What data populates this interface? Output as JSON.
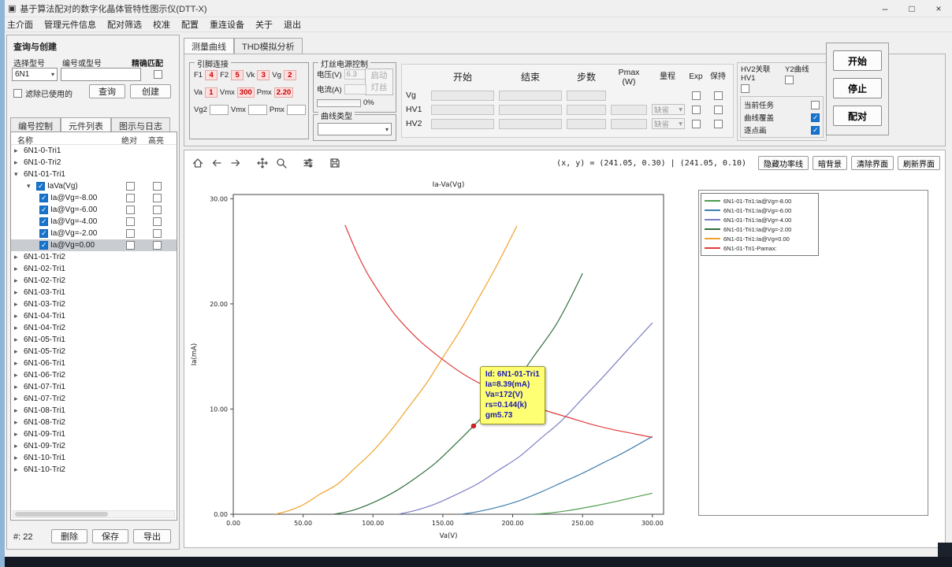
{
  "window": {
    "title": "基于算法配对的数字化晶体管特性图示仪(DTT-X)",
    "controls": {
      "minimize": "–",
      "maximize": "□",
      "close": "×"
    }
  },
  "menu": {
    "items": [
      "主介面",
      "管理元件信息",
      "配对筛选",
      "校准",
      "配置",
      "重连设备",
      "关于",
      "退出"
    ]
  },
  "query_panel": {
    "title": "查询与创建",
    "model_label": "选择型号",
    "model_value": "6N1",
    "code_label": "编号或型号",
    "code_value": "",
    "exact_label": "精确匹配",
    "filter_label": "滤除已使用的",
    "query_btn": "查询",
    "create_btn": "创建",
    "tabs": [
      {
        "label": "编号控制",
        "active": false
      },
      {
        "label": "元件列表",
        "active": true
      },
      {
        "label": "图示与日志",
        "active": false
      }
    ],
    "tree": {
      "columns": [
        "名称",
        "绝对",
        "高亮"
      ],
      "items": [
        {
          "label": "6N1-0-Tri1",
          "depth": 0,
          "arrow": "collapsed"
        },
        {
          "label": "6N1-0-Tri2",
          "depth": 0,
          "arrow": "collapsed"
        },
        {
          "label": "6N1-01-Tri1",
          "depth": 0,
          "arrow": "expanded"
        },
        {
          "label": "IaVa(Vg)",
          "depth": 1,
          "arrow": "expanded",
          "checked": true,
          "cols": true
        },
        {
          "label": "Ia@Vg=-8.00",
          "depth": 2,
          "checked": true,
          "cols": true
        },
        {
          "label": "Ia@Vg=-6.00",
          "depth": 2,
          "checked": true,
          "cols": true
        },
        {
          "label": "Ia@Vg=-4.00",
          "depth": 2,
          "checked": true,
          "cols": true
        },
        {
          "label": "Ia@Vg=-2.00",
          "depth": 2,
          "checked": true,
          "cols": true
        },
        {
          "label": "Ia@Vg=0.00",
          "depth": 2,
          "checked": true,
          "cols": true,
          "selected": true
        },
        {
          "label": "6N1-01-Tri2",
          "depth": 0,
          "arrow": "collapsed"
        },
        {
          "label": "6N1-02-Tri1",
          "depth": 0,
          "arrow": "collapsed"
        },
        {
          "label": "6N1-02-Tri2",
          "depth": 0,
          "arrow": "collapsed"
        },
        {
          "label": "6N1-03-Tri1",
          "depth": 0,
          "arrow": "collapsed"
        },
        {
          "label": "6N1-03-Tri2",
          "depth": 0,
          "arrow": "collapsed"
        },
        {
          "label": "6N1-04-Tri1",
          "depth": 0,
          "arrow": "collapsed"
        },
        {
          "label": "6N1-04-Tri2",
          "depth": 0,
          "arrow": "collapsed"
        },
        {
          "label": "6N1-05-Tri1",
          "depth": 0,
          "arrow": "collapsed"
        },
        {
          "label": "6N1-05-Tri2",
          "depth": 0,
          "arrow": "collapsed"
        },
        {
          "label": "6N1-06-Tri1",
          "depth": 0,
          "arrow": "collapsed"
        },
        {
          "label": "6N1-06-Tri2",
          "depth": 0,
          "arrow": "collapsed"
        },
        {
          "label": "6N1-07-Tri1",
          "depth": 0,
          "arrow": "collapsed"
        },
        {
          "label": "6N1-07-Tri2",
          "depth": 0,
          "arrow": "collapsed"
        },
        {
          "label": "6N1-08-Tri1",
          "depth": 0,
          "arrow": "collapsed"
        },
        {
          "label": "6N1-08-Tri2",
          "depth": 0,
          "arrow": "collapsed"
        },
        {
          "label": "6N1-09-Tri1",
          "depth": 0,
          "arrow": "collapsed"
        },
        {
          "label": "6N1-09-Tri2",
          "depth": 0,
          "arrow": "collapsed"
        },
        {
          "label": "6N1-10-Tri1",
          "depth": 0,
          "arrow": "collapsed"
        },
        {
          "label": "6N1-10-Tri2",
          "depth": 0,
          "arrow": "collapsed"
        }
      ]
    },
    "count": "#: 22",
    "delete_btn": "删除",
    "save_btn": "保存",
    "export_btn": "导出"
  },
  "main": {
    "tabs": [
      {
        "label": "测量曲线",
        "active": true
      },
      {
        "label": "THD模拟分析",
        "active": false
      }
    ],
    "pin_group": {
      "title": "引脚连接",
      "rows": [
        [
          {
            "label": "F1",
            "value": "4"
          },
          {
            "label": "F2",
            "value": "5"
          },
          {
            "label": "Vk",
            "value": "3"
          },
          {
            "label": "Vg",
            "value": "2"
          }
        ],
        [
          {
            "label": "Va",
            "value": "1"
          },
          {
            "label": "Vmx",
            "value": "300"
          },
          {
            "label": "Pmx",
            "value": "2.20"
          }
        ],
        [
          {
            "label": "Vg2",
            "value": ""
          },
          {
            "label": "Vmx",
            "value": ""
          },
          {
            "label": "Pmx",
            "value": ""
          }
        ]
      ]
    },
    "filament_group": {
      "title": "灯丝电源控制",
      "voltage_label": "电压(V)",
      "voltage_value": "6.3",
      "start_btn": "启动灯丝",
      "current_label": "电流(A)",
      "current_value": "",
      "progress": "0%"
    },
    "curve_type_group": {
      "title": "曲线类型",
      "value": ""
    },
    "sweep_table": {
      "headers": [
        "开始",
        "结束",
        "步数",
        "Pmax\n(W)",
        "量程",
        "Exp",
        "保持"
      ],
      "rows": [
        {
          "name": "Vg",
          "has_pmax": false,
          "range": null,
          "exp": false,
          "hold": false
        },
        {
          "name": "HV1",
          "has_pmax": true,
          "range": "缺省",
          "exp": false,
          "hold": false
        },
        {
          "name": "HV2",
          "has_pmax": true,
          "range": "缺省",
          "exp": false,
          "hold": false
        }
      ]
    },
    "options": {
      "hv2_link_label": "HV2关联HV1",
      "hv2_link_checked": false,
      "y2_label": "Y2曲线",
      "y2_checked": false,
      "items": [
        {
          "label": "当前任务",
          "checked": false
        },
        {
          "label": "曲线覆盖",
          "checked": true
        },
        {
          "label": "逐点画",
          "checked": true
        }
      ]
    },
    "actions": {
      "start": "开始",
      "stop": "停止",
      "pair": "配对"
    }
  },
  "chart_toolbar": {
    "icons": [
      "home",
      "back",
      "forward",
      "pan",
      "zoom",
      "tune",
      "save"
    ],
    "coords": "(x, y) = (241.05, 0.30)  |  (241.05, 0.10)",
    "buttons": [
      "隐藏功率线",
      "暗背景",
      "清除界面",
      "刷新界面"
    ]
  },
  "chart_data": {
    "type": "line",
    "title": "Ia-Va(Vg)",
    "xlabel": "Va(V)",
    "ylabel": "Ia(mA)",
    "xlim": [
      0,
      308
    ],
    "ylim": [
      0,
      30.4
    ],
    "x_ticks": [
      0,
      50,
      100,
      150,
      200,
      250,
      300
    ],
    "x_tick_labels": [
      "0.00",
      "50.00",
      "100.00",
      "150.00",
      "200.00",
      "250.00",
      "300.00"
    ],
    "y_ticks": [
      0,
      10,
      20,
      30
    ],
    "y_tick_labels": [
      "0.00",
      "10.00",
      "20.00",
      "30.00"
    ],
    "grid": false,
    "legend_position": "top-right separate box",
    "series": [
      {
        "name": "6N1-01-Tri1:Ia@Vg=-8.00",
        "color": "#4d9e4d",
        "points": [
          [
            213,
            0
          ],
          [
            225,
            0.1
          ],
          [
            240,
            0.35
          ],
          [
            255,
            0.7
          ],
          [
            270,
            1.1
          ],
          [
            285,
            1.55
          ],
          [
            300,
            2.0
          ]
        ]
      },
      {
        "name": "6N1-01-Tri1:Ia@Vg=-6.00",
        "color": "#3d7fb0",
        "points": [
          [
            163,
            0
          ],
          [
            175,
            0.25
          ],
          [
            190,
            0.7
          ],
          [
            205,
            1.3
          ],
          [
            220,
            2.1
          ],
          [
            235,
            3.0
          ],
          [
            250,
            3.9
          ],
          [
            265,
            4.9
          ],
          [
            280,
            5.9
          ],
          [
            300,
            7.4
          ]
        ]
      },
      {
        "name": "6N1-01-Tri1:Ia@Vg=-4.00",
        "color": "#7b7ec4",
        "points": [
          [
            118,
            0
          ],
          [
            130,
            0.35
          ],
          [
            145,
            1.0
          ],
          [
            160,
            1.9
          ],
          [
            175,
            2.9
          ],
          [
            190,
            4.2
          ],
          [
            205,
            5.5
          ],
          [
            220,
            7.2
          ],
          [
            235,
            8.9
          ],
          [
            250,
            11.0
          ],
          [
            265,
            13.1
          ],
          [
            280,
            15.3
          ],
          [
            300,
            18.2
          ]
        ]
      },
      {
        "name": "6N1-01-Tri1:Ia@Vg=-2.00",
        "color": "#2f6f3c",
        "points": [
          [
            72,
            0
          ],
          [
            85,
            0.35
          ],
          [
            100,
            1.1
          ],
          [
            115,
            2.1
          ],
          [
            130,
            3.4
          ],
          [
            145,
            4.9
          ],
          [
            160,
            6.8
          ],
          [
            172,
            8.39
          ],
          [
            185,
            10.2
          ],
          [
            200,
            12.2
          ],
          [
            215,
            15.0
          ],
          [
            230,
            17.8
          ],
          [
            240,
            20.2
          ],
          [
            250,
            22.9
          ]
        ]
      },
      {
        "name": "6N1-01-Tri1:Ia@Vg=0.00",
        "color": "#efa32b",
        "points": [
          [
            30,
            0
          ],
          [
            40,
            0.35
          ],
          [
            50,
            0.9
          ],
          [
            62,
            1.9
          ],
          [
            75,
            2.9
          ],
          [
            88,
            4.5
          ],
          [
            100,
            6.0
          ],
          [
            113,
            8.0
          ],
          [
            125,
            10.1
          ],
          [
            138,
            12.4
          ],
          [
            150,
            14.9
          ],
          [
            163,
            17.6
          ],
          [
            175,
            20.4
          ],
          [
            188,
            23.5
          ],
          [
            203,
            27.4
          ]
        ]
      },
      {
        "name": "6N1-01-Tri1-Pamax:",
        "color": "#e13b3b",
        "points": [
          [
            80,
            27.5
          ],
          [
            88,
            25.0
          ],
          [
            96,
            22.9
          ],
          [
            105,
            21.0
          ],
          [
            115,
            19.1
          ],
          [
            125,
            17.6
          ],
          [
            135,
            16.3
          ],
          [
            150,
            14.7
          ],
          [
            165,
            13.3
          ],
          [
            180,
            12.2
          ],
          [
            195,
            11.3
          ],
          [
            210,
            10.5
          ],
          [
            225,
            9.8
          ],
          [
            240,
            9.2
          ],
          [
            255,
            8.6
          ],
          [
            270,
            8.1
          ],
          [
            285,
            7.7
          ],
          [
            300,
            7.3
          ]
        ]
      }
    ],
    "marker": {
      "x": 172,
      "y": 8.39,
      "series": "6N1-01-Tri1:Ia@Vg=-2.00",
      "color": "#dd2222"
    },
    "tooltip": {
      "lines": [
        "Id: 6N1-01-Tri1",
        "Ia=8.39(mA)",
        "Va=172(V)",
        "rs=0.144(k)",
        "gm5.73"
      ]
    }
  }
}
